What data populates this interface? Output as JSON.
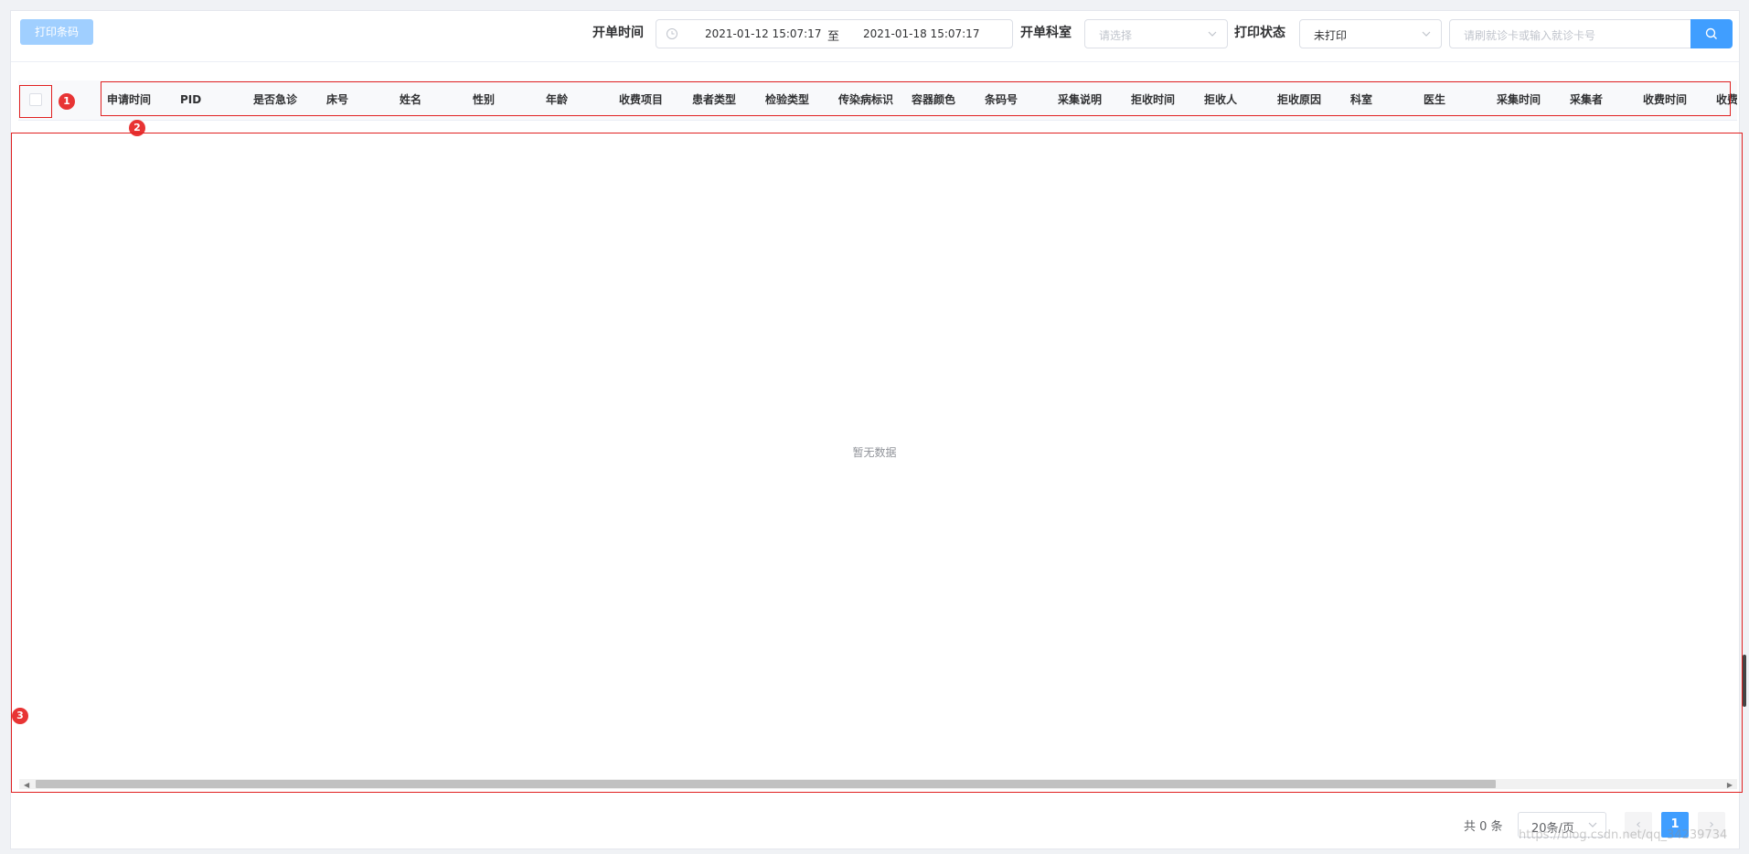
{
  "toolbar": {
    "print_button": "打印条码",
    "open_time_label": "开单时间",
    "start_date": "2021-01-12 15:07:17",
    "range_separator": "至",
    "end_date": "2021-01-18 15:07:17",
    "dept_label": "开单科室",
    "dept_placeholder": "请选择",
    "print_status_label": "打印状态",
    "print_status_value": "未打印",
    "search_placeholder": "请刷就诊卡或输入就诊卡号"
  },
  "table": {
    "columns": [
      "申请时间",
      "PID",
      "是否急诊",
      "床号",
      "姓名",
      "性别",
      "年龄",
      "收费项目",
      "患者类型",
      "检验类型",
      "传染病标识",
      "容器颜色",
      "条码号",
      "采集说明",
      "拒收时间",
      "拒收人",
      "拒收原因",
      "科室",
      "医生",
      "采集时间",
      "采集者",
      "收费时间",
      "收费"
    ],
    "empty_text": "暂无数据"
  },
  "annotations": [
    "1",
    "2",
    "3"
  ],
  "pagination": {
    "total": "共 0 条",
    "page_size": "20条/页",
    "prev": "‹",
    "current_page": "1",
    "next": "›"
  },
  "watermark": "https://blog.csdn.net/qq_34239734",
  "colors": {
    "primary": "#409eff",
    "primary_disabled": "#a0cfff",
    "annotation_red": "#e02020"
  }
}
